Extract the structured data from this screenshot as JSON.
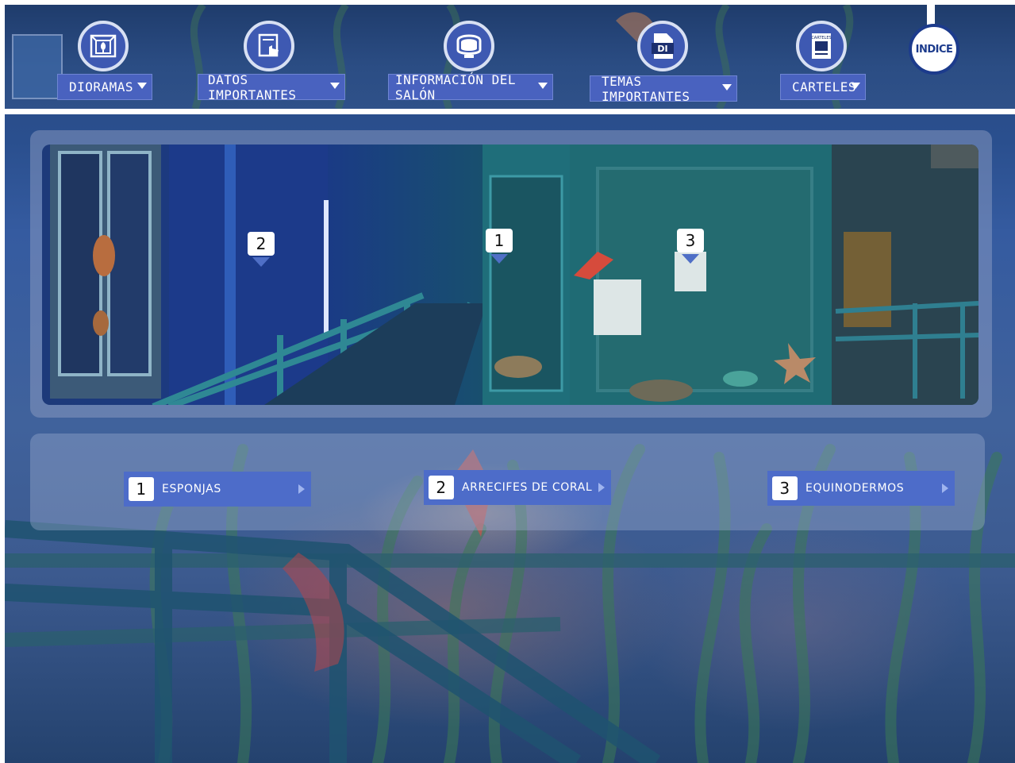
{
  "nav": {
    "items": [
      {
        "label": "DIORAMAS",
        "icon": "diorama-icon"
      },
      {
        "label": "DATOS IMPORTANTES",
        "icon": "touch-document-icon"
      },
      {
        "label": "INFORMACIÓN DEL SALÓN",
        "icon": "screen-icon"
      },
      {
        "label": "TEMAS IMPORTANTES",
        "icon": "di-file-icon"
      },
      {
        "label": "CARTELES",
        "icon": "poster-icon"
      }
    ],
    "indice": "INDICE",
    "icon_texts": {
      "file": "DI",
      "poster": "CARTELES"
    }
  },
  "panorama": {
    "hotspots": [
      {
        "number": "2"
      },
      {
        "number": "1"
      },
      {
        "number": "3"
      }
    ]
  },
  "links": [
    {
      "number": "1",
      "label": "ESPONJAS"
    },
    {
      "number": "2",
      "label": "ARRECIFES DE CORAL"
    },
    {
      "number": "3",
      "label": "EQUINODERMOS"
    }
  ],
  "colors": {
    "accent": "#4d6cc9",
    "nav_circle": "#3e59b2",
    "indice_border": "#1c3b8c"
  }
}
